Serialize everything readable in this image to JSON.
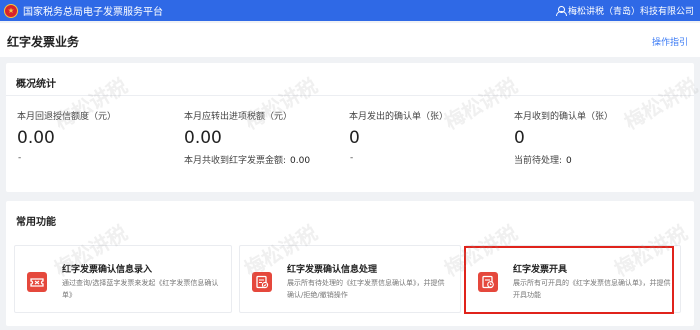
{
  "header": {
    "app_title": "国家税务总局电子发票服务平台",
    "user_name": "梅松讲税（青岛）科技有限公司"
  },
  "page": {
    "title": "红字发票业务",
    "guide_link": "操作指引"
  },
  "stats": {
    "section_title": "概况统计",
    "items": [
      {
        "label": "本月回退授信额度（元）",
        "value": "0.00",
        "sub": "-"
      },
      {
        "label": "本月应转出进项税额（元）",
        "value": "0.00",
        "sub_label": "本月共收到红字发票金额:",
        "sub_value": "0.00"
      },
      {
        "label": "本月发出的确认单（张）",
        "value": "0",
        "sub": "-"
      },
      {
        "label": "本月收到的确认单（张）",
        "value": "0",
        "sub_label": "当前待处理:",
        "sub_value": "0"
      }
    ]
  },
  "functions": {
    "section_title": "常用功能",
    "items": [
      {
        "name": "红字发票确认信息录入",
        "desc": "通过查询/选择蓝字发票来发起《红字发票信息确认单》",
        "icon": "ticket-icon"
      },
      {
        "name": "红字发票确认信息处理",
        "desc": "展示所有待处理的《红字发票信息确认单》，并提供确认/拒绝/撤销操作",
        "icon": "document-check-icon"
      },
      {
        "name": "红字发票开具",
        "desc": "展示所有可开具的《红字发票信息确认单》，并提供开具功能",
        "icon": "invoice-clock-icon"
      }
    ]
  },
  "watermark": {
    "text": "梅松讲税"
  },
  "colors": {
    "topbar": "#2f69e6",
    "accent_link": "#3d7cf5",
    "icon_red": "#e5483c",
    "highlight": "#e0231b"
  }
}
